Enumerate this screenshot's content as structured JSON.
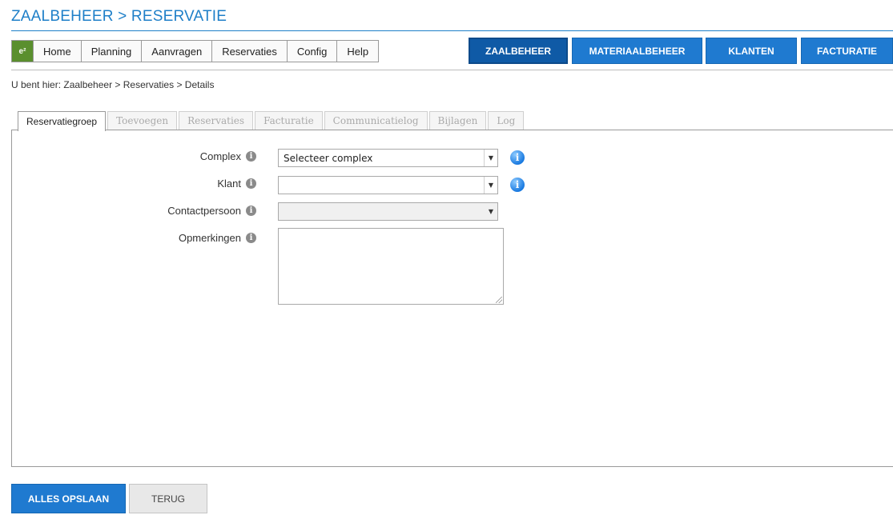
{
  "page": {
    "title": "ZAALBEHEER > RESERVATIE"
  },
  "menu": {
    "logo_icon": "app-logo-icon",
    "items": [
      "Home",
      "Planning",
      "Aanvragen",
      "Reservaties",
      "Config",
      "Help"
    ]
  },
  "modules": {
    "items": [
      {
        "label": "ZAALBEHEER",
        "active": true
      },
      {
        "label": "MATERIAALBEHEER",
        "active": false
      },
      {
        "label": "KLANTEN",
        "active": false
      },
      {
        "label": "FACTURATIE",
        "active": false
      }
    ]
  },
  "breadcrumb": "U bent hier: Zaalbeheer > Reservaties > Details",
  "tabs": [
    {
      "label": "Reservatiegroep",
      "active": true
    },
    {
      "label": "Toevoegen",
      "active": false
    },
    {
      "label": "Reservaties",
      "active": false
    },
    {
      "label": "Facturatie",
      "active": false
    },
    {
      "label": "Communicatielog",
      "active": false
    },
    {
      "label": "Bijlagen",
      "active": false
    },
    {
      "label": "Log",
      "active": false
    }
  ],
  "form": {
    "complex": {
      "label": "Complex",
      "value": "Selecteer complex"
    },
    "klant": {
      "label": "Klant",
      "value": ""
    },
    "contactpersoon": {
      "label": "Contactpersoon",
      "value": ""
    },
    "opmerkingen": {
      "label": "Opmerkingen",
      "value": ""
    }
  },
  "buttons": {
    "save": "ALLES OPSLAAN",
    "back": "TERUG"
  },
  "colors": {
    "accent": "#1f7ad0",
    "title": "#1e7fc8"
  }
}
